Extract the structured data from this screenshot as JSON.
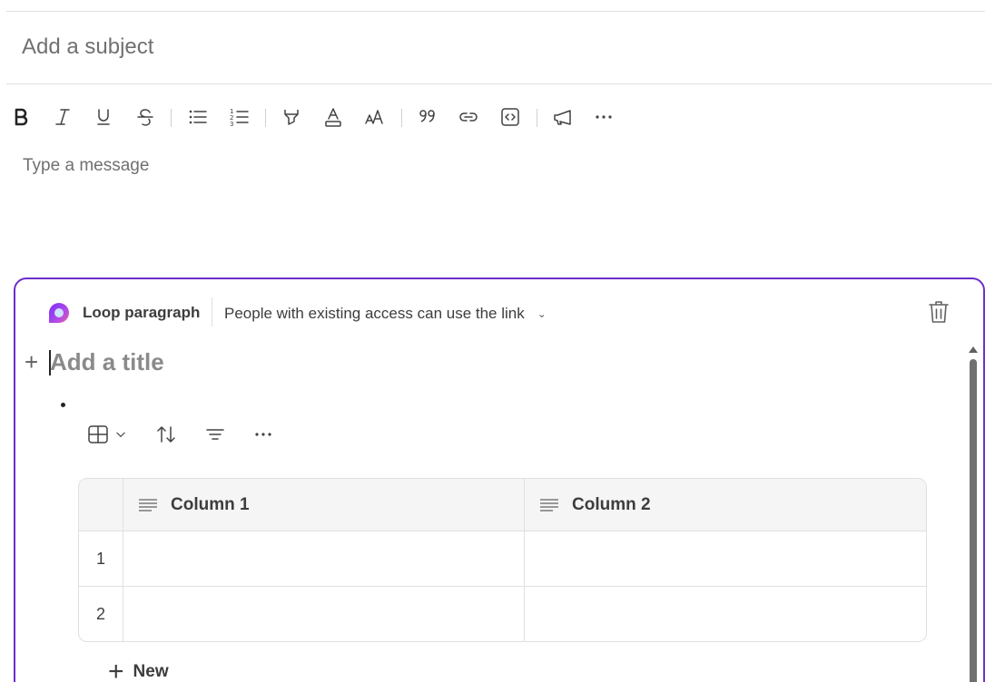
{
  "subject": {
    "placeholder": "Add a subject"
  },
  "message": {
    "placeholder": "Type a message"
  },
  "toolbar": {
    "icons": [
      "bold-icon",
      "italic-icon",
      "underline-icon",
      "strikethrough-icon",
      "bulleted-list-icon",
      "numbered-list-icon",
      "highlight-icon",
      "font-color-icon",
      "font-size-icon",
      "quote-icon",
      "link-icon",
      "code-snippet-icon",
      "announcement-icon",
      "more-options-icon"
    ]
  },
  "loop": {
    "name": "Loop paragraph",
    "access": "People with existing access can use the link",
    "title_placeholder": "Add a title",
    "accent": "#6b2fc8",
    "table": {
      "columns": [
        "Column 1",
        "Column 2"
      ],
      "rows": [
        {
          "index": "1",
          "cells": [
            "",
            ""
          ]
        },
        {
          "index": "2",
          "cells": [
            "",
            ""
          ]
        }
      ]
    },
    "new_label": "New"
  }
}
